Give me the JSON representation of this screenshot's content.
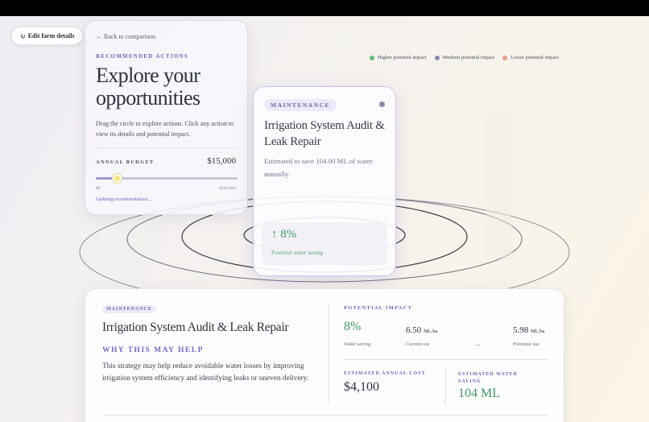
{
  "toolbar": {
    "edit_label": "Edit farm details",
    "edit_icon": "refresh-icon"
  },
  "left_panel": {
    "back_label": "← Back to comparison",
    "eyebrow": "RECOMMENDED ACTIONS",
    "title": "Explore your opportunities",
    "intro": "Drag the circle to explore actions. Click any action to view its details and potential impact.",
    "budget_label": "ANNUAL BUDGET",
    "budget_value": "$15,000",
    "budget_fraction": 0.15,
    "slider_min": "$0",
    "slider_max": "$100,000",
    "status": "Updating recommendations..."
  },
  "legend": [
    {
      "label": "Higher potential impact",
      "color": "#5fbf7a"
    },
    {
      "label": "Medium potential impact",
      "color": "#8b8ab0"
    },
    {
      "label": "Lower potential impact",
      "color": "#e99a8e"
    }
  ],
  "feature_card": {
    "tag": "MAINTENANCE",
    "title": "Irrigation System Audit & Leak Repair",
    "description": "Estimated to save 104.00 ML of water annually.",
    "impact_value": "↑ 8%",
    "impact_label": "Potential water saving"
  },
  "detail": {
    "tag": "MAINTENANCE",
    "title": "Irrigation System Audit & Leak Repair",
    "why_heading": "WHY THIS MAY HELP",
    "why_text": "This strategy may help reduce avoidable water losses by improving irrigation system efficiency and identifying leaks or uneven delivery.",
    "impact_heading": "POTENTIAL IMPACT",
    "saving_value": "8%",
    "saving_label": "Water saving",
    "current_value": "6.50",
    "current_unit": "ML/ha",
    "current_label": "Current use",
    "arrow": "→",
    "potential_value": "5.98",
    "potential_unit": "ML/ha",
    "potential_label": "Potential use",
    "cost_label": "ESTIMATED ANNUAL COST",
    "cost_value": "$4,100",
    "water_label": "ESTIMATED WATER SAVING",
    "water_value": "104 ML"
  }
}
